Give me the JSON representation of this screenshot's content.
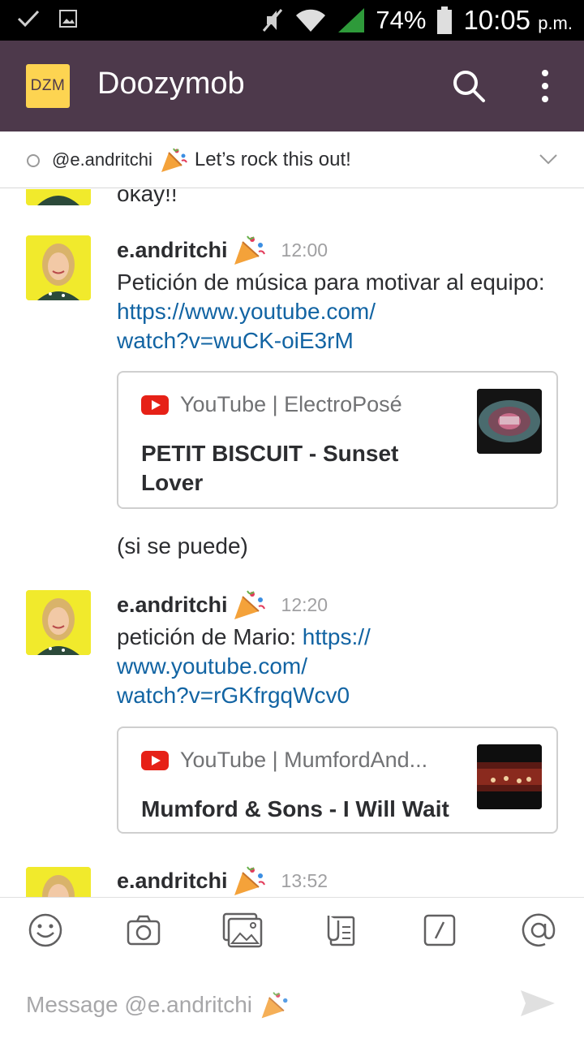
{
  "statusbar": {
    "battery": "74%",
    "time": "10:05",
    "ampm": "p.m."
  },
  "app": {
    "logo_text": "DZM",
    "title": "Doozymob"
  },
  "topic": {
    "handle": "@e.andritchi",
    "message": "Let’s rock this out!"
  },
  "messages": {
    "partial_text": "okay!!",
    "m1": {
      "user": "e.andritchi",
      "time": "12:00",
      "text": "Petición de música para motivar al equipo: ",
      "link_line1": "https://www.youtube.com/",
      "link_line2": "watch?v=wuCK-oiE3rM",
      "card": {
        "source": "YouTube | ElectroPosé",
        "title_line1": "PETIT BISCUIT - Sunset",
        "title_line2": "Lover"
      }
    },
    "followup": "(si se puede)",
    "m2": {
      "user": "e.andritchi",
      "time": "12:20",
      "text": "petición de Mario: ",
      "link_line1": "https://",
      "link_line2": "www.youtube.com/",
      "link_line3": "watch?v=rGKfrgqWcv0",
      "card": {
        "source": "YouTube | MumfordAnd...",
        "title_line1": "Mumford & Sons - I Will Wait"
      }
    },
    "m3": {
      "user": "e.andritchi",
      "time": "13:52"
    }
  },
  "composer": {
    "placeholder": "Message @e.andritchi"
  },
  "colors": {
    "appbar": "#4d394b",
    "logo": "#fdd451",
    "link": "#1264a3",
    "youtube": "#e62117"
  }
}
